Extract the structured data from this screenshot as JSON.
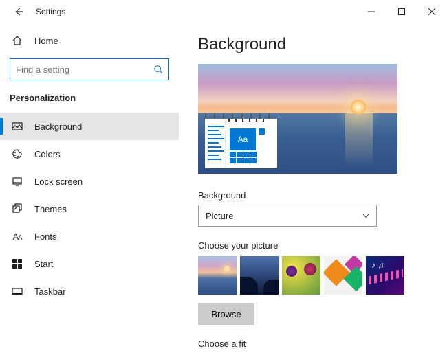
{
  "window": {
    "title": "Settings"
  },
  "sidebar": {
    "home_label": "Home",
    "search_placeholder": "Find a setting",
    "section_label": "Personalization",
    "items": [
      {
        "label": "Background",
        "icon": "picture-icon",
        "selected": true
      },
      {
        "label": "Colors",
        "icon": "palette-icon",
        "selected": false
      },
      {
        "label": "Lock screen",
        "icon": "lockscreen-icon",
        "selected": false
      },
      {
        "label": "Themes",
        "icon": "themes-icon",
        "selected": false
      },
      {
        "label": "Fonts",
        "icon": "fonts-icon",
        "selected": false
      },
      {
        "label": "Start",
        "icon": "start-icon",
        "selected": false
      },
      {
        "label": "Taskbar",
        "icon": "taskbar-icon",
        "selected": false
      }
    ]
  },
  "content": {
    "page_title": "Background",
    "preview_sample_text": "Aa",
    "bg_label": "Background",
    "bg_dropdown_value": "Picture",
    "choose_picture_label": "Choose your picture",
    "browse_label": "Browse",
    "choose_fit_label": "Choose a fit"
  }
}
